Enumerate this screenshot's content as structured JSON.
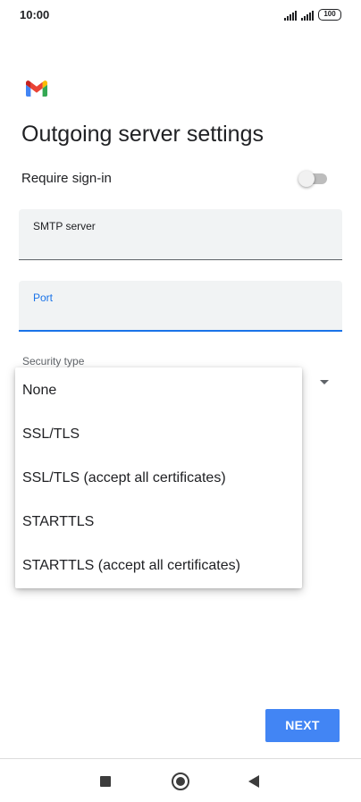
{
  "status_bar": {
    "time": "10:00",
    "signal_icon": "cell-signal-icon",
    "battery": "100"
  },
  "app": {
    "logo_icon": "gmail-logo-icon"
  },
  "page": {
    "title": "Outgoing server settings"
  },
  "require_signin": {
    "label": "Require sign-in",
    "enabled": false
  },
  "smtp_server": {
    "label": "SMTP server",
    "value": ""
  },
  "port": {
    "label": "Port",
    "value": ""
  },
  "security_type": {
    "label": "Security type",
    "options": [
      "None",
      "SSL/TLS",
      "SSL/TLS (accept all certificates)",
      "STARTTLS",
      "STARTTLS (accept all certificates)"
    ]
  },
  "actions": {
    "next_label": "NEXT"
  },
  "nav_bar": {
    "icons": [
      "recents-icon",
      "home-icon",
      "back-icon"
    ]
  },
  "colors": {
    "accent": "#1a73e8",
    "button": "#4285f4",
    "field_bg": "#f1f3f4",
    "text": "#202124"
  }
}
